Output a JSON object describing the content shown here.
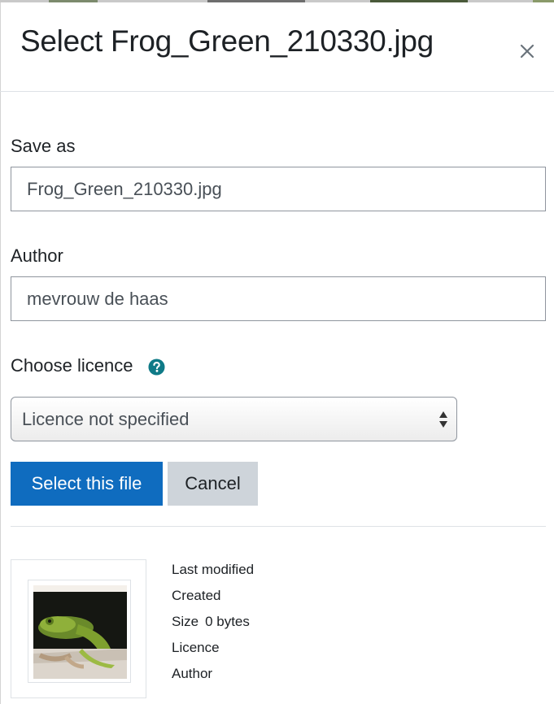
{
  "dialog": {
    "title": "Select Frog_Green_210330.jpg",
    "close_label": "×"
  },
  "form": {
    "save_as": {
      "label": "Save as",
      "value": "Frog_Green_210330.jpg"
    },
    "author": {
      "label": "Author",
      "value": "mevrouw de haas"
    },
    "licence": {
      "label": "Choose licence",
      "selected": "Licence not specified"
    }
  },
  "buttons": {
    "select_label": "Select this file",
    "cancel_label": "Cancel"
  },
  "details": {
    "last_modified_label": "Last modified",
    "created_label": "Created",
    "size_label": "Size",
    "size_value": "0 bytes",
    "licence_label": "Licence",
    "author_label": "Author"
  },
  "icons": {
    "close": "close-icon",
    "help": "question-circle-icon",
    "select_arrows": "sort-arrows-icon"
  },
  "colors": {
    "primary": "#0f6cbf",
    "secondary": "#ced4da",
    "help_icon": "#0f7a87",
    "text": "#1d2125",
    "input_border": "#8f959e"
  }
}
